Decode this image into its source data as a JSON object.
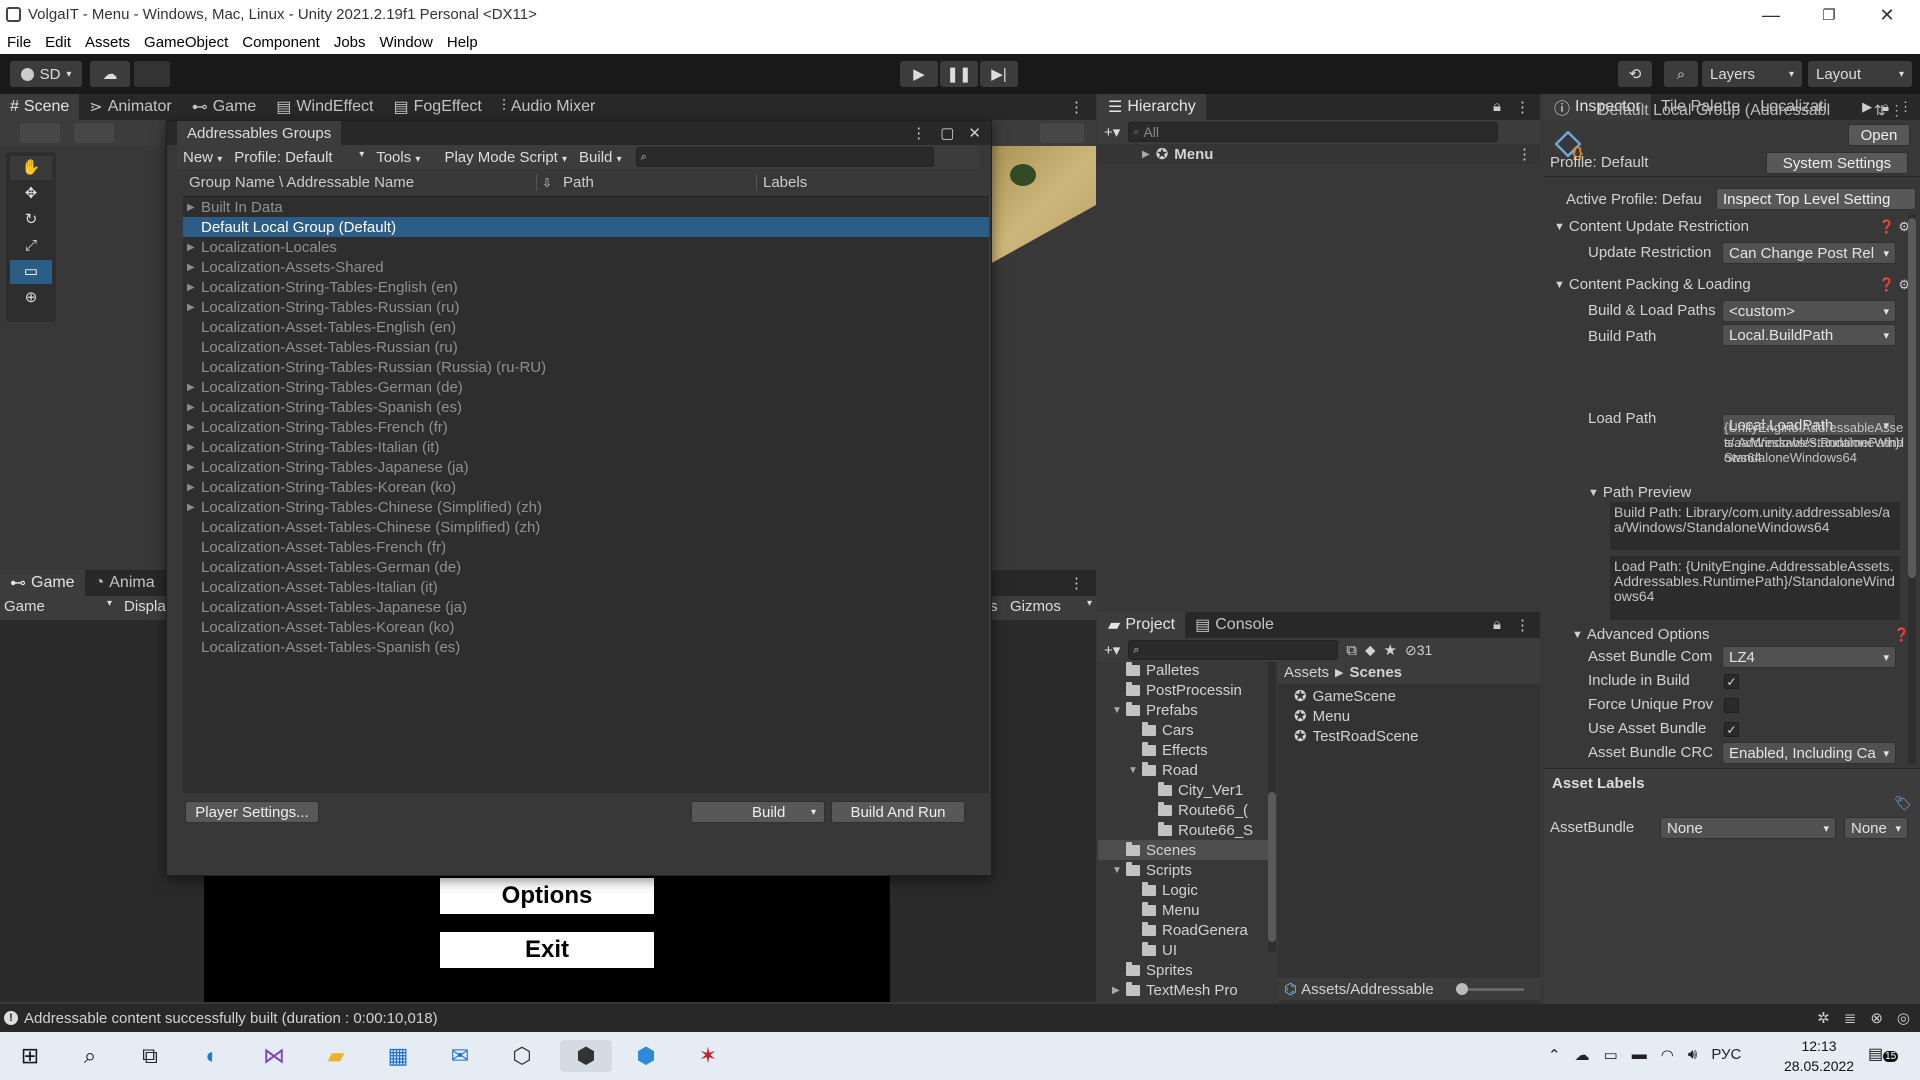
{
  "title_bar": {
    "title": "VolgaIT - Menu - Windows, Mac, Linux - Unity 2021.2.19f1 Personal <DX11>",
    "minimize": "—",
    "maximize": "❐",
    "close": "✕"
  },
  "menu": [
    "File",
    "Edit",
    "Assets",
    "GameObject",
    "Component",
    "Jobs",
    "Window",
    "Help"
  ],
  "toolbar": {
    "account": "SD",
    "layers": "Layers",
    "layout": "Layout"
  },
  "scene_tabs": [
    "Scene",
    "Animator",
    "Game",
    "WindEffect",
    "FogEffect",
    "Audio Mixer"
  ],
  "game_panel": {
    "tabs": [
      "Game",
      "Anima"
    ],
    "display_dd": "Game",
    "display_label": "Displa",
    "gizmos": "Gizmos",
    "s_label": "s",
    "options_btn": "Options",
    "exit_btn": "Exit"
  },
  "addressables": {
    "title": "Addressables Groups",
    "toolbar": {
      "new": "New",
      "profile": "Profile: Default",
      "tools": "Tools",
      "play_mode": "Play Mode Script",
      "build": "Build"
    },
    "columns": {
      "name": "Group Name \\ Addressable Name",
      "path": "Path",
      "labels": "Labels"
    },
    "rows": [
      {
        "label": "Built In Data",
        "arrow": true
      },
      {
        "label": "Default Local Group (Default)",
        "arrow": false,
        "selected": true
      },
      {
        "label": "Localization-Locales",
        "arrow": true
      },
      {
        "label": "Localization-Assets-Shared",
        "arrow": true
      },
      {
        "label": "Localization-String-Tables-English (en)",
        "arrow": true
      },
      {
        "label": "Localization-String-Tables-Russian (ru)",
        "arrow": true
      },
      {
        "label": "Localization-Asset-Tables-English (en)",
        "arrow": false
      },
      {
        "label": "Localization-Asset-Tables-Russian (ru)",
        "arrow": false
      },
      {
        "label": "Localization-String-Tables-Russian (Russia) (ru-RU)",
        "arrow": false
      },
      {
        "label": "Localization-String-Tables-German (de)",
        "arrow": true
      },
      {
        "label": "Localization-String-Tables-Spanish (es)",
        "arrow": true
      },
      {
        "label": "Localization-String-Tables-French (fr)",
        "arrow": true
      },
      {
        "label": "Localization-String-Tables-Italian (it)",
        "arrow": true
      },
      {
        "label": "Localization-String-Tables-Japanese (ja)",
        "arrow": true
      },
      {
        "label": "Localization-String-Tables-Korean (ko)",
        "arrow": true
      },
      {
        "label": "Localization-String-Tables-Chinese (Simplified) (zh)",
        "arrow": true
      },
      {
        "label": "Localization-Asset-Tables-Chinese (Simplified) (zh)",
        "arrow": false
      },
      {
        "label": "Localization-Asset-Tables-French (fr)",
        "arrow": false
      },
      {
        "label": "Localization-Asset-Tables-German (de)",
        "arrow": false
      },
      {
        "label": "Localization-Asset-Tables-Italian (it)",
        "arrow": false
      },
      {
        "label": "Localization-Asset-Tables-Japanese (ja)",
        "arrow": false
      },
      {
        "label": "Localization-Asset-Tables-Korean (ko)",
        "arrow": false
      },
      {
        "label": "Localization-Asset-Tables-Spanish (es)",
        "arrow": false
      }
    ],
    "footer": {
      "player_settings": "Player Settings...",
      "build": "Build",
      "build_and_run": "Build And Run"
    }
  },
  "hierarchy": {
    "tab": "Hierarchy",
    "search_placeholder": "All",
    "root": "Menu"
  },
  "project": {
    "tabs": [
      "Project",
      "Console"
    ],
    "hidden_count": "31",
    "tree": [
      {
        "label": "Palletes",
        "indent": 0,
        "arrow": ""
      },
      {
        "label": "PostProcessin",
        "indent": 0,
        "arrow": ""
      },
      {
        "label": "Prefabs",
        "indent": 0,
        "arrow": "▼"
      },
      {
        "label": "Cars",
        "indent": 1,
        "arrow": ""
      },
      {
        "label": "Effects",
        "indent": 1,
        "arrow": ""
      },
      {
        "label": "Road",
        "indent": 1,
        "arrow": "▼"
      },
      {
        "label": "City_Ver1",
        "indent": 2,
        "arrow": ""
      },
      {
        "label": "Route66_(",
        "indent": 2,
        "arrow": ""
      },
      {
        "label": "Route66_S",
        "indent": 2,
        "arrow": ""
      },
      {
        "label": "Scenes",
        "indent": 0,
        "arrow": "",
        "selected": true
      },
      {
        "label": "Scripts",
        "indent": 0,
        "arrow": "▼"
      },
      {
        "label": "Logic",
        "indent": 1,
        "arrow": ""
      },
      {
        "label": "Menu",
        "indent": 1,
        "arrow": ""
      },
      {
        "label": "RoadGenera",
        "indent": 1,
        "arrow": ""
      },
      {
        "label": "UI",
        "indent": 1,
        "arrow": ""
      },
      {
        "label": "Sprites",
        "indent": 0,
        "arrow": ""
      },
      {
        "label": "TextMesh Pro",
        "indent": 0,
        "arrow": "▶"
      }
    ],
    "breadcrumb": [
      "Assets",
      "Scenes"
    ],
    "files": [
      "GameScene",
      "Menu",
      "TestRoadScene"
    ],
    "bottom_path": "Assets/Addressable"
  },
  "inspector": {
    "tabs": [
      "Inspector",
      "Tile Palette",
      "Localizati"
    ],
    "object_name": "Default Local Group (Addressabl",
    "open": "Open",
    "profile": "Profile: Default",
    "system_settings": "System Settings",
    "active_profile_label": "Active Profile: Defau",
    "inspect_top": "Inspect Top Level Setting",
    "section_content_update": "Content Update Restriction",
    "update_restriction_label": "Update Restriction",
    "update_restriction_value": "Can Change Post Rel",
    "section_packing": "Content Packing & Loading",
    "build_load_paths_label": "Build & Load Paths",
    "build_load_paths_value": "<custom>",
    "build_path_label": "Build Path",
    "build_path_value": "Local.BuildPath",
    "build_path_resolved": "Library/com.unity.addressables/aa/Windows/StandaloneWindows64",
    "load_path_label": "Load Path",
    "load_path_value": "Local.LoadPath",
    "load_path_resolved": "{UnityEngine.AddressableAssets.Addressables.RuntimePath}/StandaloneWindows64",
    "path_preview": "Path Preview",
    "preview_build": "Build Path: Library/com.unity.addressables/aa/Windows/StandaloneWindows64",
    "preview_load": "Load Path: {UnityEngine.AddressableAssets.Addressables.RuntimePath}/StandaloneWindows64",
    "advanced": "Advanced Options",
    "compression_label": "Asset Bundle Com",
    "compression_value": "LZ4",
    "include_in_build": "Include in Build",
    "force_unique": "Force Unique Prov",
    "use_asset_bundle": "Use Asset Bundle",
    "crc_label": "Asset Bundle CRC",
    "crc_value": "Enabled, Including Ca",
    "asset_labels": "Asset Labels",
    "assetbundle_label": "AssetBundle",
    "assetbundle_value": "None",
    "assetbundle_variant": "None"
  },
  "status_bar": {
    "message": "Addressable content successfully built (duration : 0:00:10,018)"
  },
  "taskbar": {
    "lang": "РУС",
    "time": "12:13",
    "date": "28.05.2022",
    "notif": "15"
  },
  "colors": {
    "selection": "#2c5d87",
    "panel": "#383838",
    "dark": "#191919"
  }
}
